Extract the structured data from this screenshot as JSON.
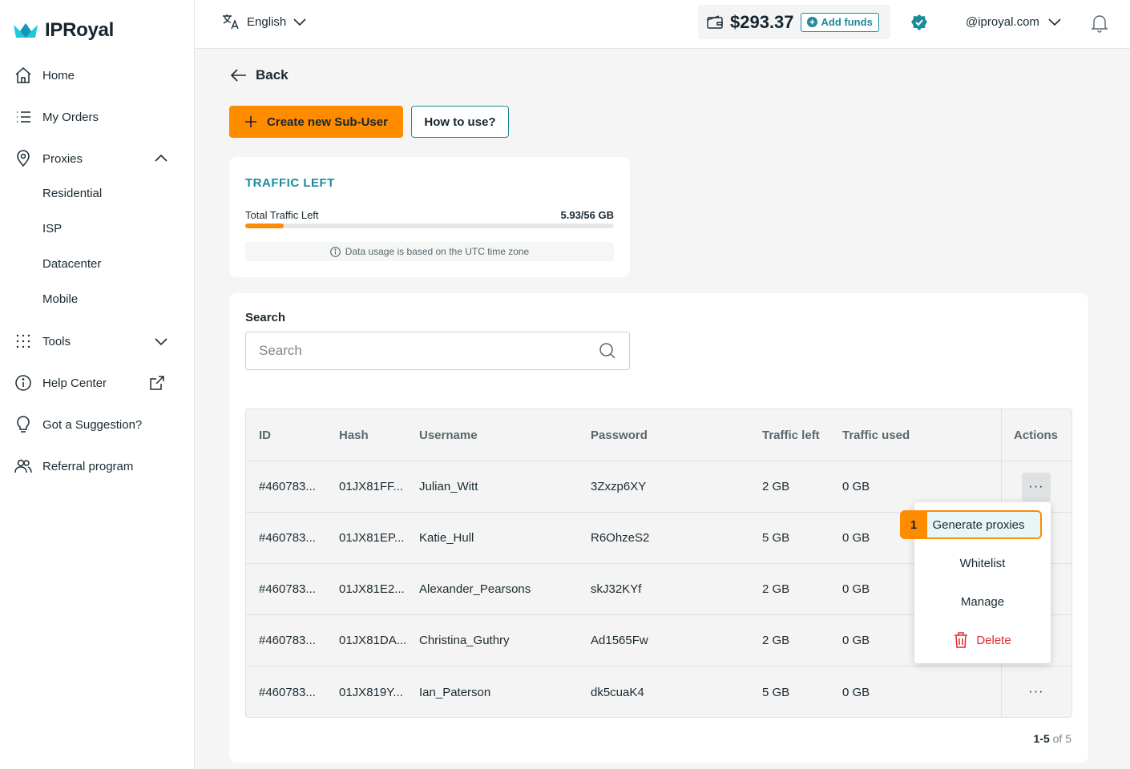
{
  "brand": {
    "name": "IPRoyal"
  },
  "sidebar": {
    "items": [
      {
        "label": "Home"
      },
      {
        "label": "My Orders"
      },
      {
        "label": "Proxies"
      },
      {
        "label": "Tools"
      },
      {
        "label": "Help Center"
      },
      {
        "label": "Got a Suggestion?"
      },
      {
        "label": "Referral program"
      }
    ],
    "proxies_sub": [
      "Residential",
      "ISP",
      "Datacenter",
      "Mobile"
    ]
  },
  "topbar": {
    "language": "English",
    "balance": "$293.37",
    "add_funds": "Add funds",
    "account": "@iproyal.com"
  },
  "main": {
    "back_label": "Back",
    "create_button": "Create new Sub-User",
    "howto_button": "How to use?",
    "traffic": {
      "title": "TRAFFIC LEFT",
      "label": "Total Traffic Left",
      "value": "5.93/56 GB",
      "progress_fraction": 0.105,
      "note": "Data usage is based on the UTC time zone"
    },
    "search": {
      "label": "Search",
      "placeholder": "Search"
    },
    "table": {
      "headers": [
        "ID",
        "Hash",
        "Username",
        "Password",
        "Traffic left",
        "Traffic used",
        "Actions"
      ],
      "rows": [
        {
          "id": "#460783...",
          "hash": "01JX81FF...",
          "username": "Julian_Witt",
          "password": "3Zxzp6XY",
          "traffic_left": "2 GB",
          "traffic_used": "0 GB"
        },
        {
          "id": "#460783...",
          "hash": "01JX81EP...",
          "username": "Katie_Hull",
          "password": "R6OhzeS2",
          "traffic_left": "5 GB",
          "traffic_used": "0 GB"
        },
        {
          "id": "#460783...",
          "hash": "01JX81E2...",
          "username": "Alexander_Pearsons",
          "password": "skJ32KYf",
          "traffic_left": "2 GB",
          "traffic_used": "0 GB"
        },
        {
          "id": "#460783...",
          "hash": "01JX81DA...",
          "username": "Christina_Guthry",
          "password": "Ad1565Fw",
          "traffic_left": "2 GB",
          "traffic_used": "0 GB"
        },
        {
          "id": "#460783...",
          "hash": "01JX819Y...",
          "username": "Ian_Paterson",
          "password": "dk5cuaK4",
          "traffic_left": "5 GB",
          "traffic_used": "0 GB"
        }
      ],
      "actions_glyph": "···"
    },
    "pagination": {
      "range": "1-5",
      "of_label": "of 5"
    }
  },
  "menu": {
    "step": "1",
    "items": [
      "Generate proxies",
      "Whitelist",
      "Manage",
      "Delete"
    ]
  },
  "colors": {
    "accent": "#ff8c00",
    "teal": "#1d8a99",
    "danger": "#e0282d"
  }
}
